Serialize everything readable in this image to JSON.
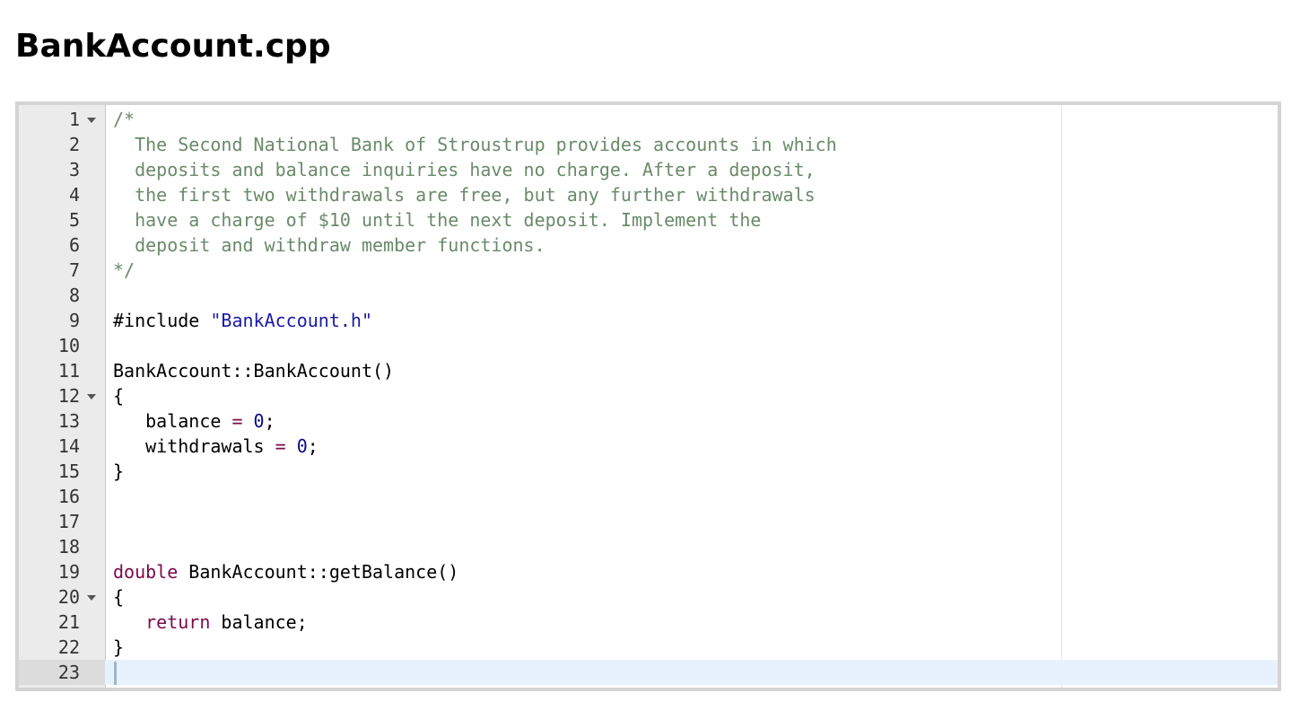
{
  "title": "BankAccount.cpp",
  "editor": {
    "lines": [
      {
        "n": "1",
        "fold": true,
        "tokens": [
          {
            "t": "/*",
            "c": "comment"
          }
        ]
      },
      {
        "n": "2",
        "fold": false,
        "tokens": [
          {
            "t": "  The Second National Bank of Stroustrup provides accounts in which",
            "c": "comment"
          }
        ]
      },
      {
        "n": "3",
        "fold": false,
        "tokens": [
          {
            "t": "  deposits and balance inquiries have no charge. After a deposit,",
            "c": "comment"
          }
        ]
      },
      {
        "n": "4",
        "fold": false,
        "tokens": [
          {
            "t": "  the first two withdrawals are free, but any further withdrawals",
            "c": "comment"
          }
        ]
      },
      {
        "n": "5",
        "fold": false,
        "tokens": [
          {
            "t": "  have a charge of $10 until the next deposit. Implement the",
            "c": "comment"
          }
        ]
      },
      {
        "n": "6",
        "fold": false,
        "tokens": [
          {
            "t": "  deposit and withdraw member functions.",
            "c": "comment"
          }
        ]
      },
      {
        "n": "7",
        "fold": false,
        "tokens": [
          {
            "t": "*/",
            "c": "comment"
          }
        ]
      },
      {
        "n": "8",
        "fold": false,
        "tokens": []
      },
      {
        "n": "9",
        "fold": false,
        "tokens": [
          {
            "t": "#include ",
            "c": "plain"
          },
          {
            "t": "\"BankAccount.h\"",
            "c": "string"
          }
        ]
      },
      {
        "n": "10",
        "fold": false,
        "tokens": []
      },
      {
        "n": "11",
        "fold": false,
        "tokens": [
          {
            "t": "BankAccount::BankAccount()",
            "c": "plain"
          }
        ]
      },
      {
        "n": "12",
        "fold": true,
        "tokens": [
          {
            "t": "{",
            "c": "plain"
          }
        ]
      },
      {
        "n": "13",
        "fold": false,
        "tokens": [
          {
            "t": "   balance ",
            "c": "plain"
          },
          {
            "t": "=",
            "c": "operator"
          },
          {
            "t": " ",
            "c": "plain"
          },
          {
            "t": "0",
            "c": "number"
          },
          {
            "t": ";",
            "c": "plain"
          }
        ]
      },
      {
        "n": "14",
        "fold": false,
        "tokens": [
          {
            "t": "   withdrawals ",
            "c": "plain"
          },
          {
            "t": "=",
            "c": "operator"
          },
          {
            "t": " ",
            "c": "plain"
          },
          {
            "t": "0",
            "c": "number"
          },
          {
            "t": ";",
            "c": "plain"
          }
        ]
      },
      {
        "n": "15",
        "fold": false,
        "tokens": [
          {
            "t": "}",
            "c": "plain"
          }
        ]
      },
      {
        "n": "16",
        "fold": false,
        "tokens": []
      },
      {
        "n": "17",
        "fold": false,
        "tokens": []
      },
      {
        "n": "18",
        "fold": false,
        "tokens": []
      },
      {
        "n": "19",
        "fold": false,
        "tokens": [
          {
            "t": "double",
            "c": "keyword"
          },
          {
            "t": " BankAccount::getBalance()",
            "c": "plain"
          }
        ]
      },
      {
        "n": "20",
        "fold": true,
        "tokens": [
          {
            "t": "{",
            "c": "plain"
          }
        ]
      },
      {
        "n": "21",
        "fold": false,
        "tokens": [
          {
            "t": "   ",
            "c": "plain"
          },
          {
            "t": "return",
            "c": "keyword"
          },
          {
            "t": " balance;",
            "c": "plain"
          }
        ]
      },
      {
        "n": "22",
        "fold": false,
        "tokens": [
          {
            "t": "}",
            "c": "plain"
          }
        ]
      },
      {
        "n": "23",
        "fold": false,
        "active": true,
        "tokens": []
      }
    ]
  }
}
